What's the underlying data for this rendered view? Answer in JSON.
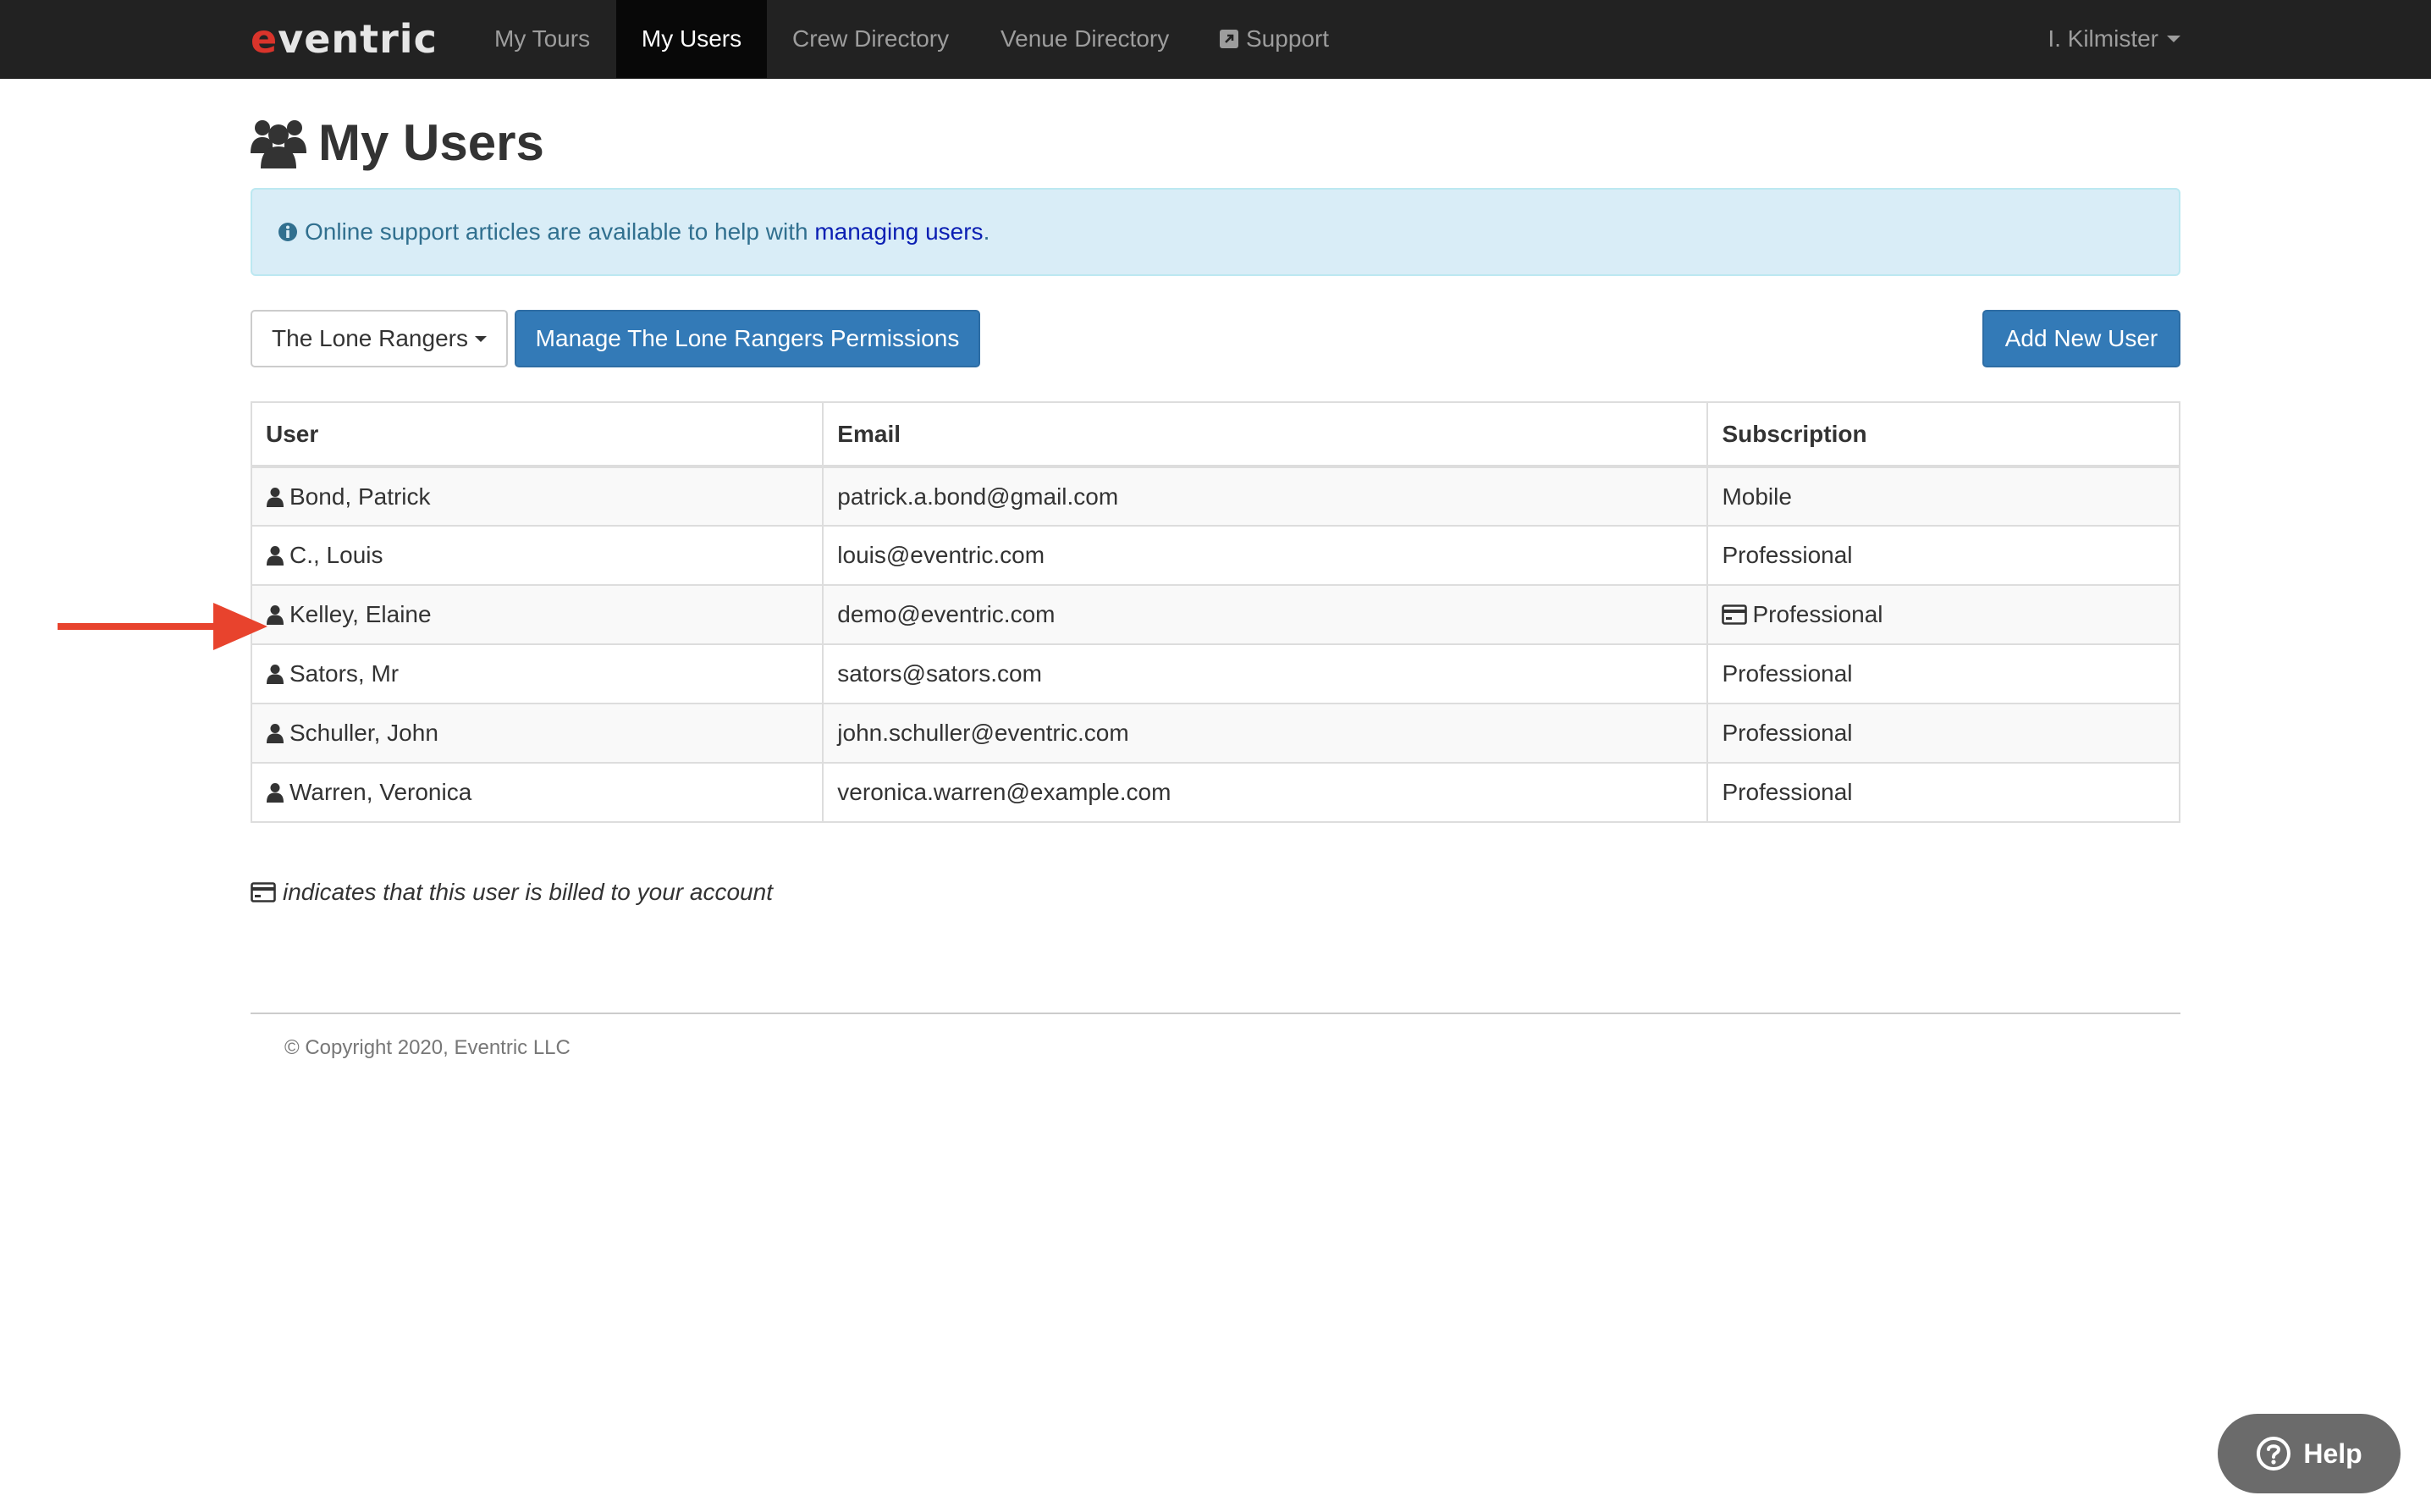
{
  "brand": {
    "name": "eventric"
  },
  "nav": {
    "items": [
      {
        "label": "My Tours"
      },
      {
        "label": "My Users"
      },
      {
        "label": "Crew Directory"
      },
      {
        "label": "Venue Directory"
      },
      {
        "label": "Support"
      }
    ],
    "active": "My Users",
    "user_menu": "I. Kilmister"
  },
  "page": {
    "title": "My Users"
  },
  "alert": {
    "text_before": "Online support articles are available to help with ",
    "link_text": "managing users",
    "text_after": "."
  },
  "toolbar": {
    "group_select": "The Lone Rangers",
    "permissions_button": "Manage The Lone Rangers Permissions",
    "add_user_button": "Add New User"
  },
  "table": {
    "headers": [
      "User",
      "Email",
      "Subscription"
    ],
    "rows": [
      {
        "user": "Bond, Patrick",
        "email": "patrick.a.bond@gmail.com",
        "subscription": "Mobile",
        "billed": false
      },
      {
        "user": "C., Louis",
        "email": "louis@eventric.com",
        "subscription": "Professional",
        "billed": false
      },
      {
        "user": "Kelley, Elaine",
        "email": "demo@eventric.com",
        "subscription": "Professional",
        "billed": true
      },
      {
        "user": "Sators, Mr",
        "email": "sators@sators.com",
        "subscription": "Professional",
        "billed": false
      },
      {
        "user": "Schuller, John",
        "email": "john.schuller@eventric.com",
        "subscription": "Professional",
        "billed": false
      },
      {
        "user": "Warren, Veronica",
        "email": "veronica.warren@example.com",
        "subscription": "Professional",
        "billed": false
      }
    ]
  },
  "legend": {
    "text": "indicates that this user is billed to your account"
  },
  "footer": {
    "copyright": "© Copyright 2020, Eventric LLC"
  },
  "help": {
    "label": "Help"
  },
  "colors": {
    "navbar": "#222222",
    "primary": "#337ab7",
    "alert_bg": "#d9edf7",
    "arrow": "#e8432d",
    "brand_accent": "#d9342b"
  }
}
